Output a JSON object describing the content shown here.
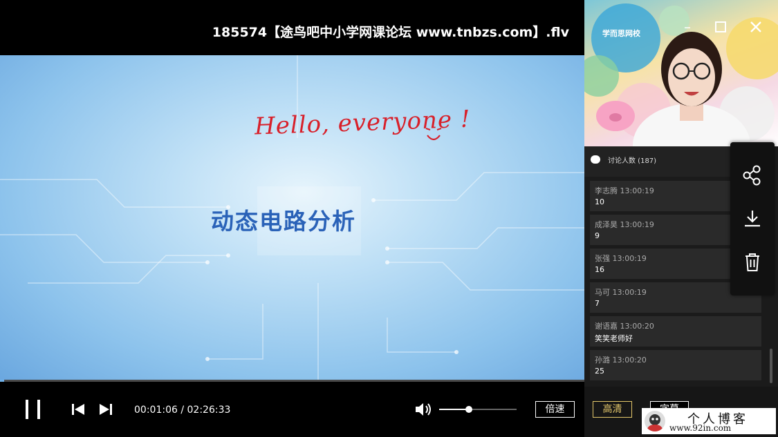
{
  "window": {
    "title": "185574【途鸟吧中小学网课论坛 www.tnbzs.com】.flv"
  },
  "slide": {
    "greeting": "Hello, everyone ! ",
    "title": "动态电路分析"
  },
  "player": {
    "progress": 0.0075,
    "current_time": "00:01:06",
    "separator": " / ",
    "total_time": "02:26:33",
    "volume": 0.38,
    "speed_label": "倍速",
    "quality_label": "高清",
    "third_label": "字幕"
  },
  "chat": {
    "header": "讨论人数 (187)",
    "messages": [
      {
        "name": "李志腾",
        "time": "13:00:19",
        "text": "10"
      },
      {
        "name": "成泽昊",
        "time": "13:00:19",
        "text": "9"
      },
      {
        "name": "张强",
        "time": "13:00:19",
        "text": "16"
      },
      {
        "name": "马可",
        "time": "13:00:19",
        "text": "7"
      },
      {
        "name": "谢语嘉",
        "time": "13:00:20",
        "text": "笑笑老师好"
      },
      {
        "name": "孙潞",
        "time": "13:00:20",
        "text": "25"
      }
    ]
  },
  "webcam": {
    "logo_text": "学而思网校"
  },
  "watermark": {
    "title": "个人博客",
    "url": "www.92in.com"
  },
  "colors": {
    "accent_blue": "#2a62b8",
    "handwriting_red": "#d8202a",
    "quality_gold": "#e5c86b"
  },
  "icons": [
    "pause-icon",
    "skip-previous-icon",
    "skip-next-icon",
    "volume-icon",
    "minimize-icon",
    "maximize-icon",
    "close-icon",
    "chat-bubble-icon",
    "share-icon",
    "download-icon",
    "trash-icon"
  ]
}
